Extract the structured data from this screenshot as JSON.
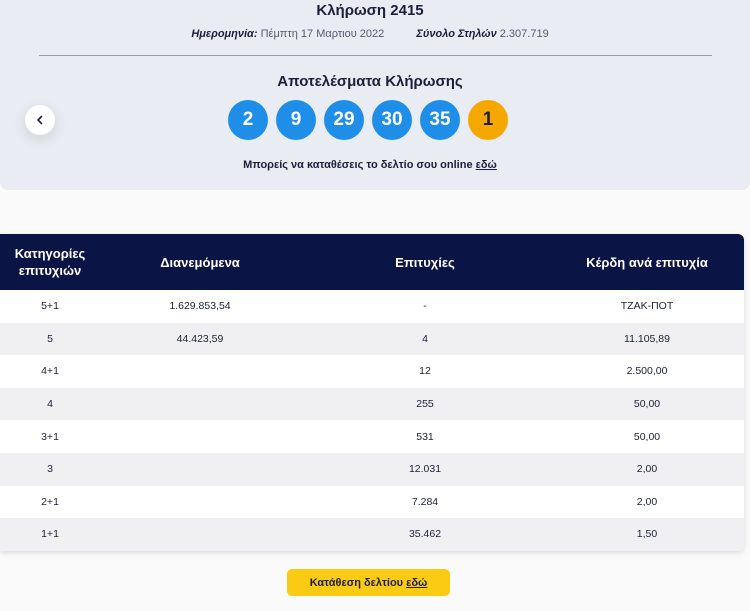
{
  "draw": {
    "title": "Κλήρωση 2415",
    "date_label": "Ημερομηνία:",
    "date_value": "Πέμπτη 17 Μαρτιου 2022",
    "columns_label": "Σύνολο Στηλών",
    "columns_value": "2.307.719"
  },
  "results": {
    "title": "Αποτελέσματα Κλήρωσης",
    "numbers": [
      "2",
      "9",
      "29",
      "30",
      "35"
    ],
    "joker": "1",
    "colors": {
      "number_ball": "#1e8ee8",
      "joker_ball": "#f7a800"
    }
  },
  "online": {
    "text": "Μπορείς να καταθέσεις το δελτίο σου online",
    "link": "εδώ"
  },
  "prev_button": {
    "icon": "chevron-left-icon"
  },
  "table": {
    "headers": {
      "category": "Κατηγορίες επιτυχιών",
      "distributed": "Διανεμόμενα",
      "winners": "Επιτυχίες",
      "prize": "Κέρδη ανά επιτυχία"
    },
    "rows": [
      {
        "category": "5+1",
        "distributed": "1.629.853,54",
        "winners": "-",
        "prize": "ΤΖΑΚ-ΠΟΤ"
      },
      {
        "category": "5",
        "distributed": "44.423,59",
        "winners": "4",
        "prize": "11.105,89"
      },
      {
        "category": "4+1",
        "distributed": "",
        "winners": "12",
        "prize": "2.500,00"
      },
      {
        "category": "4",
        "distributed": "",
        "winners": "255",
        "prize": "50,00"
      },
      {
        "category": "3+1",
        "distributed": "",
        "winners": "531",
        "prize": "50,00"
      },
      {
        "category": "3",
        "distributed": "",
        "winners": "12.031",
        "prize": "2,00"
      },
      {
        "category": "2+1",
        "distributed": "",
        "winners": "7.284",
        "prize": "2,00"
      },
      {
        "category": "1+1",
        "distributed": "",
        "winners": "35.462",
        "prize": "1,50"
      }
    ]
  },
  "cta": {
    "label": "Κατάθεση δελτίου",
    "link": "εδώ",
    "color": "#fbcb14"
  }
}
